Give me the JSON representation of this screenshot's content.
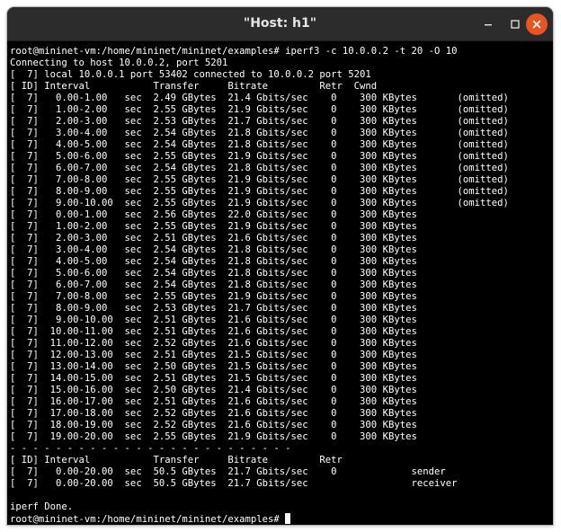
{
  "window": {
    "title": "\"Host: h1\""
  },
  "terminal": {
    "lines": [
      "root@mininet-vm:/home/mininet/mininet/examples# iperf3 -c 10.0.0.2 -t 20 -O 10",
      "Connecting to host 10.0.0.2, port 5201",
      "[  7] local 10.0.0.1 port 53402 connected to 10.0.0.2 port 5201",
      "[ ID] Interval           Transfer     Bitrate         Retr  Cwnd",
      "[  7]   0.00-1.00   sec  2.49 GBytes  21.4 Gbits/sec    0    300 KBytes       (omitted)",
      "[  7]   1.00-2.00   sec  2.55 GBytes  21.9 Gbits/sec    0    300 KBytes       (omitted)",
      "[  7]   2.00-3.00   sec  2.53 GBytes  21.7 Gbits/sec    0    300 KBytes       (omitted)",
      "[  7]   3.00-4.00   sec  2.54 GBytes  21.8 Gbits/sec    0    300 KBytes       (omitted)",
      "[  7]   4.00-5.00   sec  2.54 GBytes  21.8 Gbits/sec    0    300 KBytes       (omitted)",
      "[  7]   5.00-6.00   sec  2.55 GBytes  21.9 Gbits/sec    0    300 KBytes       (omitted)",
      "[  7]   6.00-7.00   sec  2.54 GBytes  21.8 Gbits/sec    0    300 KBytes       (omitted)",
      "[  7]   7.00-8.00   sec  2.55 GBytes  21.9 Gbits/sec    0    300 KBytes       (omitted)",
      "[  7]   8.00-9.00   sec  2.55 GBytes  21.9 Gbits/sec    0    300 KBytes       (omitted)",
      "[  7]   9.00-10.00  sec  2.55 GBytes  21.9 Gbits/sec    0    300 KBytes       (omitted)",
      "[  7]   0.00-1.00   sec  2.56 GBytes  22.0 Gbits/sec    0    300 KBytes",
      "[  7]   1.00-2.00   sec  2.55 GBytes  21.9 Gbits/sec    0    300 KBytes",
      "[  7]   2.00-3.00   sec  2.51 GBytes  21.6 Gbits/sec    0    300 KBytes",
      "[  7]   3.00-4.00   sec  2.54 GBytes  21.8 Gbits/sec    0    300 KBytes",
      "[  7]   4.00-5.00   sec  2.54 GBytes  21.8 Gbits/sec    0    300 KBytes",
      "[  7]   5.00-6.00   sec  2.54 GBytes  21.8 Gbits/sec    0    300 KBytes",
      "[  7]   6.00-7.00   sec  2.54 GBytes  21.8 Gbits/sec    0    300 KBytes",
      "[  7]   7.00-8.00   sec  2.55 GBytes  21.9 Gbits/sec    0    300 KBytes",
      "[  7]   8.00-9.00   sec  2.53 GBytes  21.7 Gbits/sec    0    300 KBytes",
      "[  7]   9.00-10.00  sec  2.51 GBytes  21.6 Gbits/sec    0    300 KBytes",
      "[  7]  10.00-11.00  sec  2.51 GBytes  21.6 Gbits/sec    0    300 KBytes",
      "[  7]  11.00-12.00  sec  2.52 GBytes  21.6 Gbits/sec    0    300 KBytes",
      "[  7]  12.00-13.00  sec  2.51 GBytes  21.5 Gbits/sec    0    300 KBytes",
      "[  7]  13.00-14.00  sec  2.50 GBytes  21.5 Gbits/sec    0    300 KBytes",
      "[  7]  14.00-15.00  sec  2.51 GBytes  21.5 Gbits/sec    0    300 KBytes",
      "[  7]  15.00-16.00  sec  2.50 GBytes  21.4 Gbits/sec    0    300 KBytes",
      "[  7]  16.00-17.00  sec  2.51 GBytes  21.6 Gbits/sec    0    300 KBytes",
      "[  7]  17.00-18.00  sec  2.52 GBytes  21.6 Gbits/sec    0    300 KBytes",
      "[  7]  18.00-19.00  sec  2.52 GBytes  21.6 Gbits/sec    0    300 KBytes",
      "[  7]  19.00-20.00  sec  2.55 GBytes  21.9 Gbits/sec    0    300 KBytes",
      "- - - - - - - - - - - - - - - - - - - - - - - - -",
      "[ ID] Interval           Transfer     Bitrate         Retr",
      "[  7]   0.00-20.00  sec  50.5 GBytes  21.7 Gbits/sec    0             sender",
      "[  7]   0.00-20.00  sec  50.5 GBytes  21.7 Gbits/sec                  receiver",
      "",
      "iperf Done.",
      "root@mininet-vm:/home/mininet/mininet/examples# "
    ]
  },
  "colors": {
    "terminal_bg": "#000000",
    "terminal_fg": "#ffffff",
    "titlebar_bg": "#2c2c2c",
    "close_button": "#e95420"
  }
}
